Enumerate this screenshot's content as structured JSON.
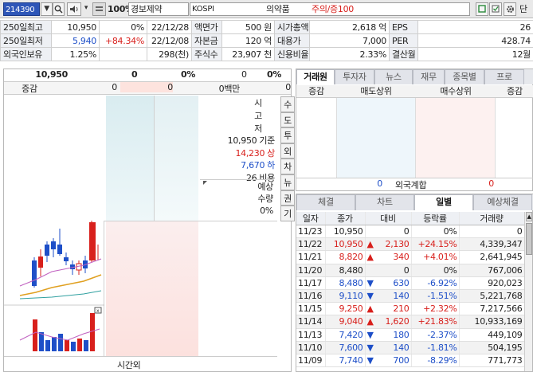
{
  "toolbar": {
    "code": "214390",
    "zoom": "100%",
    "stock_name": "경보제약",
    "market": "KOSPI",
    "sector": "의약품",
    "warning": "주의/증100",
    "right_label": "단"
  },
  "stats": {
    "rows": [
      {
        "l1": "250일최고",
        "v1": "10,950",
        "p1": "0%",
        "d1": "22/12/28",
        "l2": "액면가",
        "v2": "500 원",
        "l3": "시가총액",
        "v3": "2,618 억",
        "l4": "EPS",
        "v4": "26"
      },
      {
        "l1": "250일최저",
        "v1": "5,940",
        "p1": "+84.34%",
        "d1": "22/12/08",
        "l2": "자본금",
        "v2": "120 억",
        "l3": "대용가",
        "v3": "7,000",
        "l4": "PER",
        "v4": "428.74"
      },
      {
        "l1": "외국인보유",
        "v1": "1.25%",
        "p1": "",
        "d1": "298(천)",
        "l2": "주식수",
        "v2": "23,907 천",
        "l3": "신용비율",
        "v3": "2.33%",
        "l4": "결산월",
        "v4": "12월"
      }
    ]
  },
  "orderbook": {
    "top_price": "10,950",
    "top_zero1": "0",
    "top_pct": "0%",
    "top_zero2": "0",
    "top_pct2": "0%",
    "zg_label": "증감",
    "zg_val1": "0",
    "zg_val2": "0",
    "zg_amount": "0백만",
    "zg_val3": "0",
    "side_labels": [
      "시",
      "고",
      "저"
    ],
    "side_rows": [
      {
        "value": "10,950",
        "label": "기준",
        "color": "#222"
      },
      {
        "value": "14,230",
        "label": "상",
        "color": "#d8201c"
      },
      {
        "value": "7,670",
        "label": "하",
        "color": "#1e4fc8"
      },
      {
        "value": "26",
        "label": "비용",
        "color": "#222"
      }
    ],
    "expect_label1": "예상",
    "expect_label2": "수량",
    "expect_pct": "0%",
    "vtabs": [
      "수",
      "도",
      "투",
      "외",
      "차",
      "뉴",
      "권",
      "기"
    ],
    "bottom_label": "시간외"
  },
  "broker": {
    "tabs": [
      "거래원",
      "투자자",
      "뉴스",
      "재무",
      "종목별",
      "프로"
    ],
    "headers": [
      "증감",
      "매도상위",
      "매수상위",
      "증감"
    ],
    "foreign_label": "외국계합",
    "foreign_left": "0",
    "foreign_right": "0"
  },
  "daily": {
    "tabs": [
      "체결",
      "차트",
      "일별",
      "예상체결"
    ],
    "headers": [
      "일자",
      "종가",
      "대비",
      "등락률",
      "거래량"
    ],
    "rows": [
      {
        "date": "11/23",
        "close": "10,950",
        "arrow": "",
        "diff": "0",
        "rate": "0%",
        "vol": "0",
        "dir": "flat"
      },
      {
        "date": "11/22",
        "close": "10,950",
        "arrow": "▲",
        "diff": "2,130",
        "rate": "+24.15%",
        "vol": "4,339,347",
        "dir": "up"
      },
      {
        "date": "11/21",
        "close": "8,820",
        "arrow": "▲",
        "diff": "340",
        "rate": "+4.01%",
        "vol": "2,641,945",
        "dir": "up"
      },
      {
        "date": "11/20",
        "close": "8,480",
        "arrow": "",
        "diff": "0",
        "rate": "0%",
        "vol": "767,006",
        "dir": "flat"
      },
      {
        "date": "11/17",
        "close": "8,480",
        "arrow": "▼",
        "diff": "630",
        "rate": "-6.92%",
        "vol": "920,023",
        "dir": "dn"
      },
      {
        "date": "11/16",
        "close": "9,110",
        "arrow": "▼",
        "diff": "140",
        "rate": "-1.51%",
        "vol": "5,221,768",
        "dir": "dn"
      },
      {
        "date": "11/15",
        "close": "9,250",
        "arrow": "▲",
        "diff": "210",
        "rate": "+2.32%",
        "vol": "7,217,566",
        "dir": "up"
      },
      {
        "date": "11/14",
        "close": "9,040",
        "arrow": "▲",
        "diff": "1,620",
        "rate": "+21.83%",
        "vol": "10,933,169",
        "dir": "up"
      },
      {
        "date": "11/13",
        "close": "7,420",
        "arrow": "▼",
        "diff": "180",
        "rate": "-2.37%",
        "vol": "449,109",
        "dir": "dn"
      },
      {
        "date": "11/10",
        "close": "7,600",
        "arrow": "▼",
        "diff": "140",
        "rate": "-1.81%",
        "vol": "504,195",
        "dir": "dn"
      },
      {
        "date": "11/09",
        "close": "7,740",
        "arrow": "▼",
        "diff": "700",
        "rate": "-8.29%",
        "vol": "771,773",
        "dir": "dn"
      }
    ]
  }
}
